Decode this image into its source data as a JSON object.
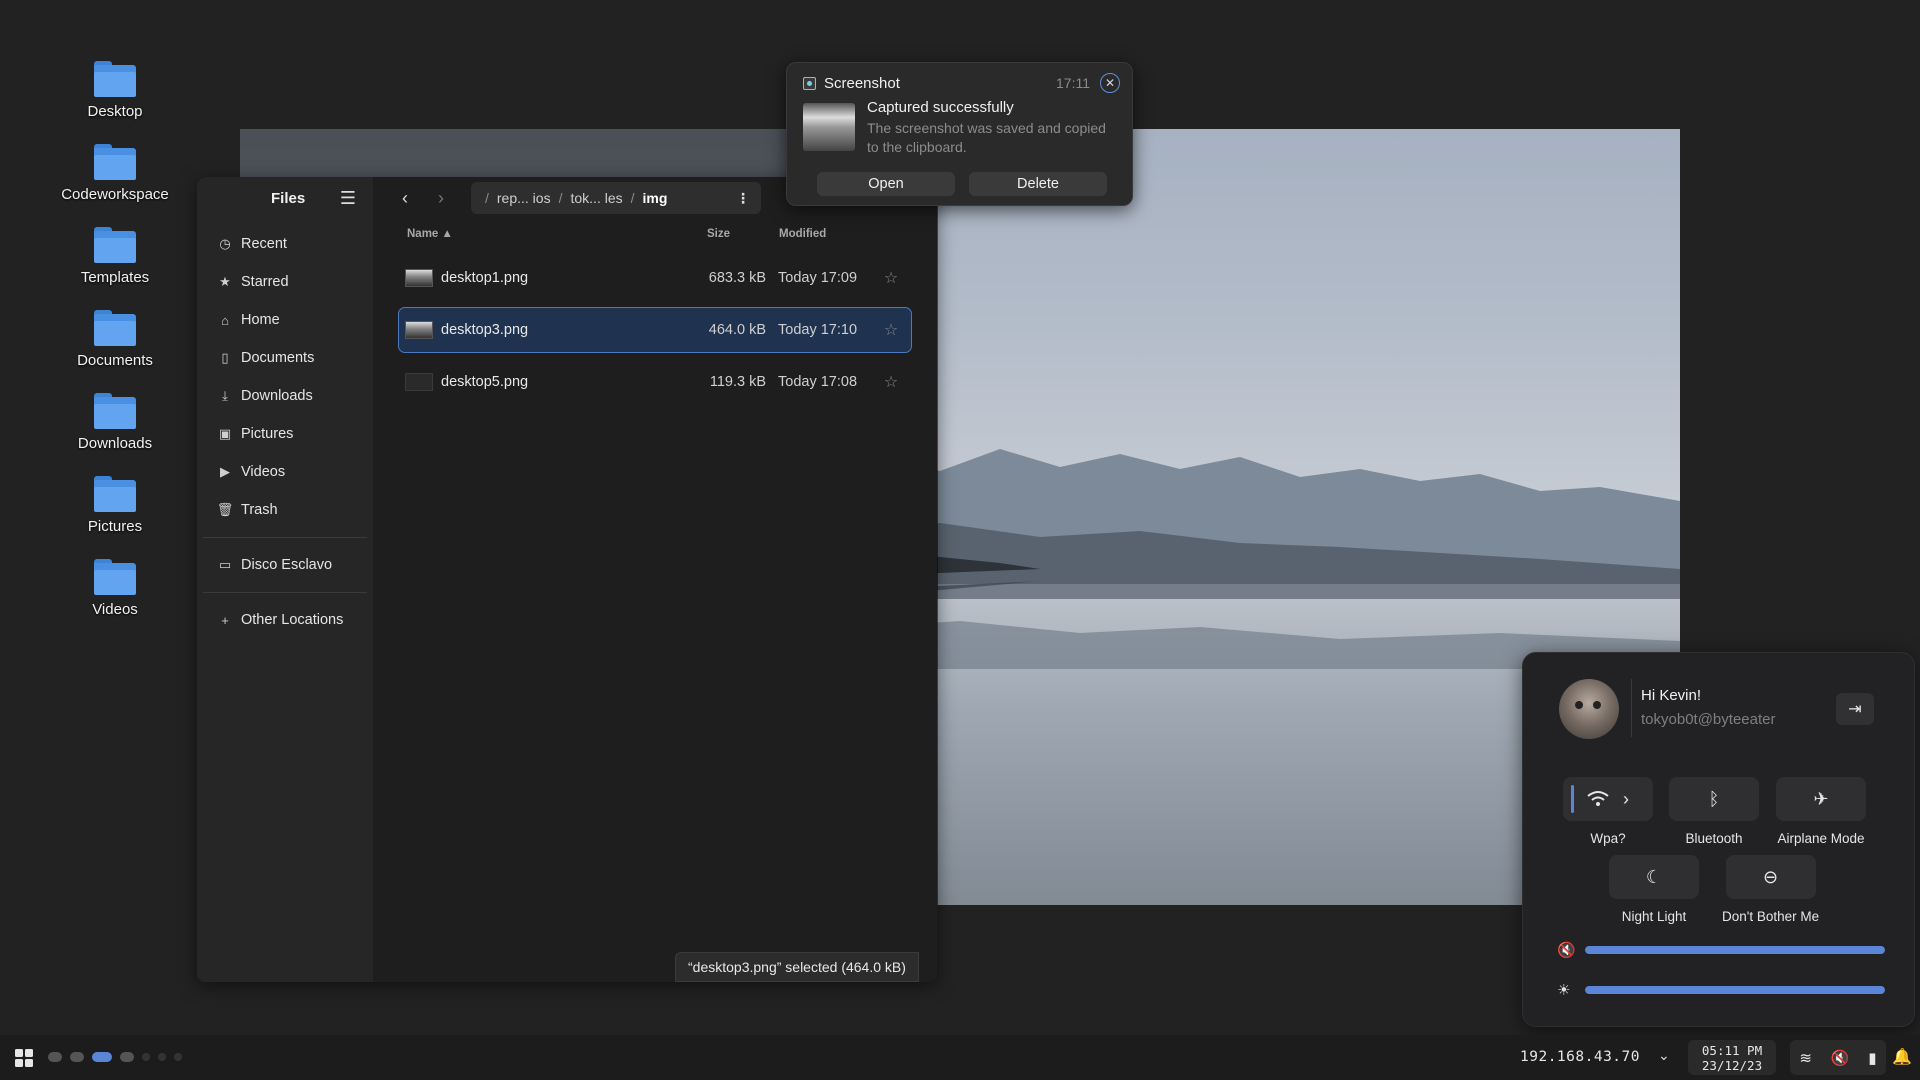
{
  "desktop": {
    "icons": [
      {
        "label": "Desktop"
      },
      {
        "label": "Codeworkspace"
      },
      {
        "label": "Templates"
      },
      {
        "label": "Documents"
      },
      {
        "label": "Downloads"
      },
      {
        "label": "Pictures"
      },
      {
        "label": "Videos"
      }
    ]
  },
  "files": {
    "title": "Files",
    "sidebar": [
      {
        "label": "Recent",
        "icon": "clock-icon"
      },
      {
        "label": "Starred",
        "icon": "star-icon"
      },
      {
        "label": "Home",
        "icon": "home-icon"
      },
      {
        "label": "Documents",
        "icon": "document-icon"
      },
      {
        "label": "Downloads",
        "icon": "download-icon"
      },
      {
        "label": "Pictures",
        "icon": "picture-icon"
      },
      {
        "label": "Videos",
        "icon": "video-icon"
      },
      {
        "label": "Trash",
        "icon": "trash-icon"
      }
    ],
    "sidebar_extra": [
      {
        "label": "Disco Esclavo",
        "icon": "folder-icon"
      },
      {
        "label": "Other Locations",
        "icon": "plus-icon"
      }
    ],
    "path": {
      "seg1": "rep... ios",
      "seg2": "tok... les",
      "current": "img"
    },
    "columns": {
      "name": "Name",
      "size": "Size",
      "modified": "Modified"
    },
    "rows": [
      {
        "name": "desktop1.png",
        "size": "683.3 kB",
        "modified": "Today 17:09"
      },
      {
        "name": "desktop3.png",
        "size": "464.0 kB",
        "modified": "Today 17:10"
      },
      {
        "name": "desktop5.png",
        "size": "119.3 kB",
        "modified": "Today 17:08"
      }
    ],
    "selected_index": 1,
    "status": "“desktop3.png” selected  (464.0 kB)"
  },
  "notification": {
    "app": "Screenshot",
    "time": "17:11",
    "title": "Captured successfully",
    "body": "The screenshot was saved and copied to the clipboard.",
    "open_label": "Open",
    "delete_label": "Delete"
  },
  "quick_settings": {
    "greeting": "Hi Kevin!",
    "user": "tokyob0t@byteeater",
    "tiles": [
      {
        "label": "Wpa?"
      },
      {
        "label": "Bluetooth"
      },
      {
        "label": "Airplane Mode"
      },
      {
        "label": "Night Light"
      },
      {
        "label": "Don't Bother Me"
      }
    ],
    "volume_level": 1.0,
    "brightness_level": 1.0
  },
  "taskbar": {
    "ip": "192.168.43.70",
    "time": "05:11 PM",
    "date": "23/12/23"
  },
  "colors": {
    "accent": "#5b86d8",
    "selected_row": "#1f3250"
  }
}
